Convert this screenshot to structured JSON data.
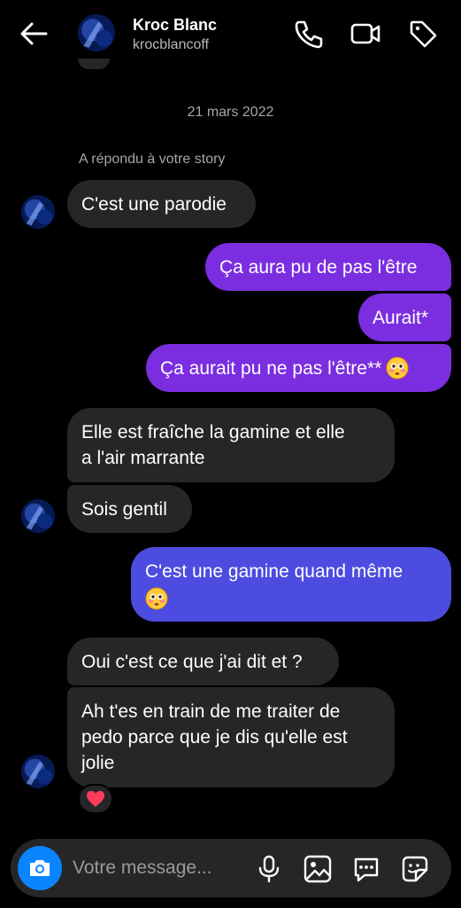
{
  "header": {
    "name": "Kroc Blanc",
    "handle": "krocblancoff",
    "icons": [
      "back-arrow-icon",
      "phone-icon",
      "video-call-icon",
      "tag-icon"
    ]
  },
  "conversation": {
    "date": "21 mars 2022",
    "story_reply_label": "A répondu à votre story",
    "messages": [
      {
        "from": "them",
        "text": "C'est une parodie"
      },
      {
        "from": "me",
        "text": "Ça aura pu de pas l'être"
      },
      {
        "from": "me",
        "text": "Aurait*"
      },
      {
        "from": "me",
        "text": "Ça aurait pu ne pas l'être**",
        "emoji": "flushed-face"
      },
      {
        "from": "them",
        "lines": [
          "Elle est fraîche la gamine et elle",
          "a l'air marrante"
        ]
      },
      {
        "from": "them",
        "text": "Sois gentil"
      },
      {
        "from": "me",
        "text": "C'est une gamine quand même",
        "emoji": "flushed-face"
      },
      {
        "from": "them",
        "text": "Oui c'est ce que j'ai dit et ?"
      },
      {
        "from": "them",
        "lines": [
          "Ah t'es en train de me traiter de",
          "pedo parce que je dis qu'elle est",
          "jolie"
        ],
        "reaction": "red-heart"
      }
    ]
  },
  "composer": {
    "placeholder": "Votre message...",
    "icons": [
      "camera-icon",
      "microphone-icon",
      "image-icon",
      "chat-bubble-icon",
      "sticker-icon"
    ]
  },
  "colors": {
    "background": "#000000",
    "incoming_bubble": "#262626",
    "outgoing_purple": "#7b2ee0",
    "outgoing_blue": "#4d4ce0",
    "camera_button": "#0a84ff"
  }
}
